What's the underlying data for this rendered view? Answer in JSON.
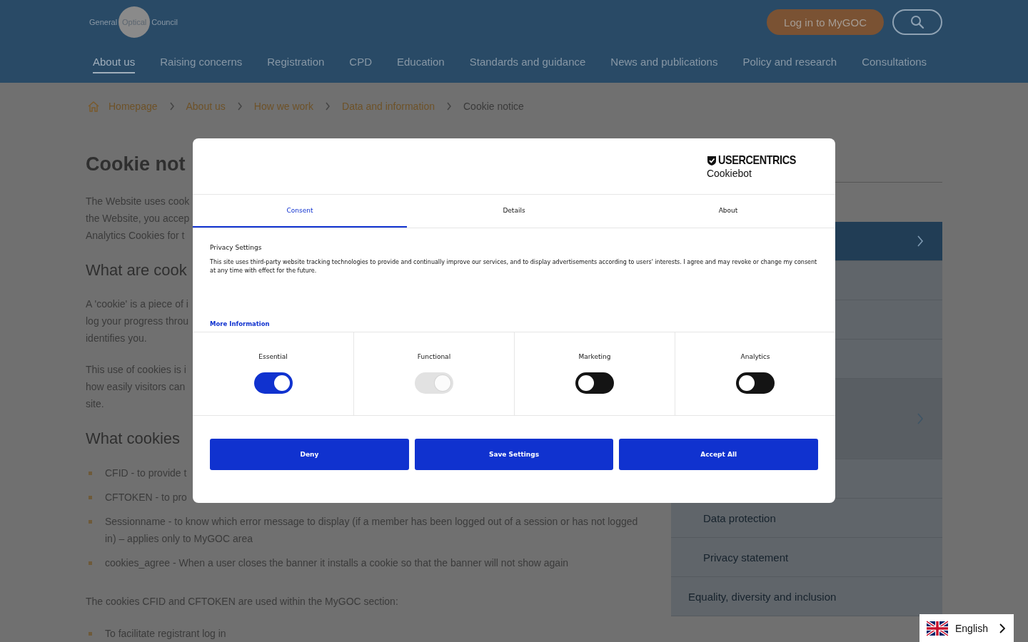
{
  "header": {
    "logo": [
      "General",
      "Optical",
      "Council"
    ],
    "login_button": "Log in to MyGOC"
  },
  "nav": [
    {
      "label": "About us",
      "selected": true
    },
    {
      "label": "Raising concerns",
      "selected": false
    },
    {
      "label": "Registration",
      "selected": false
    },
    {
      "label": "CPD",
      "selected": false
    },
    {
      "label": "Education",
      "selected": false
    },
    {
      "label": "Standards and guidance",
      "selected": false
    },
    {
      "label": "News and publications",
      "selected": false
    },
    {
      "label": "Policy and research",
      "selected": false
    },
    {
      "label": "Consultations",
      "selected": false
    }
  ],
  "breadcrumb": [
    "Homepage",
    "About us",
    "How we work",
    "Data and information",
    "Cookie notice"
  ],
  "content": [
    {
      "kind": "title",
      "text": "Cookie not"
    },
    {
      "kind": "paragraph",
      "lines": [
        "The Website uses cook",
        "the Website, you accep",
        "Analytics Cookies for t"
      ]
    },
    {
      "kind": "heading",
      "text": "What are cook"
    },
    {
      "kind": "paragraph",
      "lines": [
        "A 'cookie' is a piece of i",
        "log your progress throu",
        "identifies you."
      ]
    },
    {
      "kind": "paragraph",
      "lines": [
        "This use of cookies is i",
        "how easily visitors can",
        "site."
      ]
    },
    {
      "kind": "heading",
      "text": "What cookies"
    },
    {
      "kind": "bullets",
      "items": [
        "CFID - to provide t",
        "CFTOKEN - to pro",
        "Sessionname - to know which error message to display (if a member has been logged out of a session or has not logged in) – applies only to MyGOC area",
        "cookies_agree - When a user closes the banner it installs a cookie so that the banner will not show again"
      ]
    },
    {
      "kind": "paragraph",
      "lines": [
        "The cookies CFID and CFTOKEN are used within the MyGOC section:"
      ]
    },
    {
      "kind": "bullets",
      "items": [
        "To facilitate registrant log in"
      ]
    }
  ],
  "sidebar": [
    {
      "kind": "section",
      "selected": true
    },
    {
      "kind": "link",
      "selected": false
    },
    {
      "kind": "link",
      "selected": false
    },
    {
      "kind": "link",
      "selected": false
    },
    {
      "kind": "section-open",
      "selected": false
    },
    {
      "kind": "sub",
      "selected": false
    },
    {
      "kind": "sub",
      "selected": false,
      "label": "Data protection"
    },
    {
      "kind": "sub",
      "selected": false,
      "label": "Privacy statement"
    },
    {
      "kind": "link",
      "selected": false,
      "label": "Equality, diversity and inclusion"
    }
  ],
  "dialog": {
    "brand": "USERCENTRICS",
    "product": "Cookiebot",
    "tabs": [
      {
        "label": "Consent",
        "selected": true
      },
      {
        "label": "Details",
        "selected": false
      },
      {
        "label": "About",
        "selected": false
      }
    ],
    "title": "Privacy Settings",
    "text": "This site uses third-party website tracking technologies to provide and continually improve our services, and to display advertisements according to users' interests. I agree and may revoke or change my consent at any time with effect for the future.",
    "more_link": "More Information",
    "categories": [
      {
        "label": "Essential",
        "checked": true,
        "disabled": false
      },
      {
        "label": "Functional",
        "checked": true,
        "disabled": true
      },
      {
        "label": "Marketing",
        "checked": false,
        "disabled": false
      },
      {
        "label": "Analytics",
        "checked": false,
        "disabled": false
      }
    ],
    "buttons": [
      "Deny",
      "Save Settings",
      "Accept All"
    ]
  },
  "language": {
    "label": "English"
  }
}
